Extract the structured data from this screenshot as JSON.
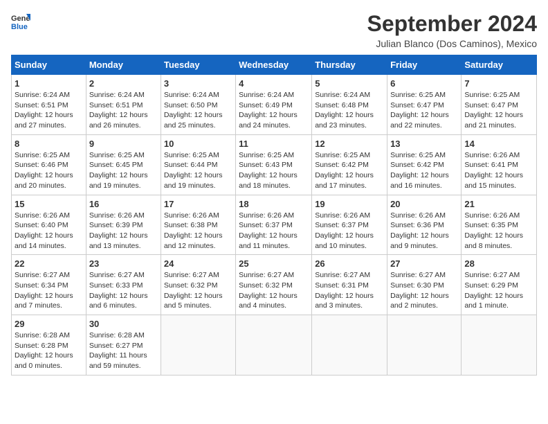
{
  "header": {
    "logo_line1": "General",
    "logo_line2": "Blue",
    "title": "September 2024",
    "subtitle": "Julian Blanco (Dos Caminos), Mexico"
  },
  "calendar": {
    "days_of_week": [
      "Sunday",
      "Monday",
      "Tuesday",
      "Wednesday",
      "Thursday",
      "Friday",
      "Saturday"
    ],
    "weeks": [
      [
        {
          "day": "1",
          "info": "Sunrise: 6:24 AM\nSunset: 6:51 PM\nDaylight: 12 hours\nand 27 minutes."
        },
        {
          "day": "2",
          "info": "Sunrise: 6:24 AM\nSunset: 6:51 PM\nDaylight: 12 hours\nand 26 minutes."
        },
        {
          "day": "3",
          "info": "Sunrise: 6:24 AM\nSunset: 6:50 PM\nDaylight: 12 hours\nand 25 minutes."
        },
        {
          "day": "4",
          "info": "Sunrise: 6:24 AM\nSunset: 6:49 PM\nDaylight: 12 hours\nand 24 minutes."
        },
        {
          "day": "5",
          "info": "Sunrise: 6:24 AM\nSunset: 6:48 PM\nDaylight: 12 hours\nand 23 minutes."
        },
        {
          "day": "6",
          "info": "Sunrise: 6:25 AM\nSunset: 6:47 PM\nDaylight: 12 hours\nand 22 minutes."
        },
        {
          "day": "7",
          "info": "Sunrise: 6:25 AM\nSunset: 6:47 PM\nDaylight: 12 hours\nand 21 minutes."
        }
      ],
      [
        {
          "day": "8",
          "info": "Sunrise: 6:25 AM\nSunset: 6:46 PM\nDaylight: 12 hours\nand 20 minutes."
        },
        {
          "day": "9",
          "info": "Sunrise: 6:25 AM\nSunset: 6:45 PM\nDaylight: 12 hours\nand 19 minutes."
        },
        {
          "day": "10",
          "info": "Sunrise: 6:25 AM\nSunset: 6:44 PM\nDaylight: 12 hours\nand 19 minutes."
        },
        {
          "day": "11",
          "info": "Sunrise: 6:25 AM\nSunset: 6:43 PM\nDaylight: 12 hours\nand 18 minutes."
        },
        {
          "day": "12",
          "info": "Sunrise: 6:25 AM\nSunset: 6:42 PM\nDaylight: 12 hours\nand 17 minutes."
        },
        {
          "day": "13",
          "info": "Sunrise: 6:25 AM\nSunset: 6:42 PM\nDaylight: 12 hours\nand 16 minutes."
        },
        {
          "day": "14",
          "info": "Sunrise: 6:26 AM\nSunset: 6:41 PM\nDaylight: 12 hours\nand 15 minutes."
        }
      ],
      [
        {
          "day": "15",
          "info": "Sunrise: 6:26 AM\nSunset: 6:40 PM\nDaylight: 12 hours\nand 14 minutes."
        },
        {
          "day": "16",
          "info": "Sunrise: 6:26 AM\nSunset: 6:39 PM\nDaylight: 12 hours\nand 13 minutes."
        },
        {
          "day": "17",
          "info": "Sunrise: 6:26 AM\nSunset: 6:38 PM\nDaylight: 12 hours\nand 12 minutes."
        },
        {
          "day": "18",
          "info": "Sunrise: 6:26 AM\nSunset: 6:37 PM\nDaylight: 12 hours\nand 11 minutes."
        },
        {
          "day": "19",
          "info": "Sunrise: 6:26 AM\nSunset: 6:37 PM\nDaylight: 12 hours\nand 10 minutes."
        },
        {
          "day": "20",
          "info": "Sunrise: 6:26 AM\nSunset: 6:36 PM\nDaylight: 12 hours\nand 9 minutes."
        },
        {
          "day": "21",
          "info": "Sunrise: 6:26 AM\nSunset: 6:35 PM\nDaylight: 12 hours\nand 8 minutes."
        }
      ],
      [
        {
          "day": "22",
          "info": "Sunrise: 6:27 AM\nSunset: 6:34 PM\nDaylight: 12 hours\nand 7 minutes."
        },
        {
          "day": "23",
          "info": "Sunrise: 6:27 AM\nSunset: 6:33 PM\nDaylight: 12 hours\nand 6 minutes."
        },
        {
          "day": "24",
          "info": "Sunrise: 6:27 AM\nSunset: 6:32 PM\nDaylight: 12 hours\nand 5 minutes."
        },
        {
          "day": "25",
          "info": "Sunrise: 6:27 AM\nSunset: 6:32 PM\nDaylight: 12 hours\nand 4 minutes."
        },
        {
          "day": "26",
          "info": "Sunrise: 6:27 AM\nSunset: 6:31 PM\nDaylight: 12 hours\nand 3 minutes."
        },
        {
          "day": "27",
          "info": "Sunrise: 6:27 AM\nSunset: 6:30 PM\nDaylight: 12 hours\nand 2 minutes."
        },
        {
          "day": "28",
          "info": "Sunrise: 6:27 AM\nSunset: 6:29 PM\nDaylight: 12 hours\nand 1 minute."
        }
      ],
      [
        {
          "day": "29",
          "info": "Sunrise: 6:28 AM\nSunset: 6:28 PM\nDaylight: 12 hours\nand 0 minutes."
        },
        {
          "day": "30",
          "info": "Sunrise: 6:28 AM\nSunset: 6:27 PM\nDaylight: 11 hours\nand 59 minutes."
        },
        {
          "day": "",
          "info": ""
        },
        {
          "day": "",
          "info": ""
        },
        {
          "day": "",
          "info": ""
        },
        {
          "day": "",
          "info": ""
        },
        {
          "day": "",
          "info": ""
        }
      ]
    ]
  }
}
